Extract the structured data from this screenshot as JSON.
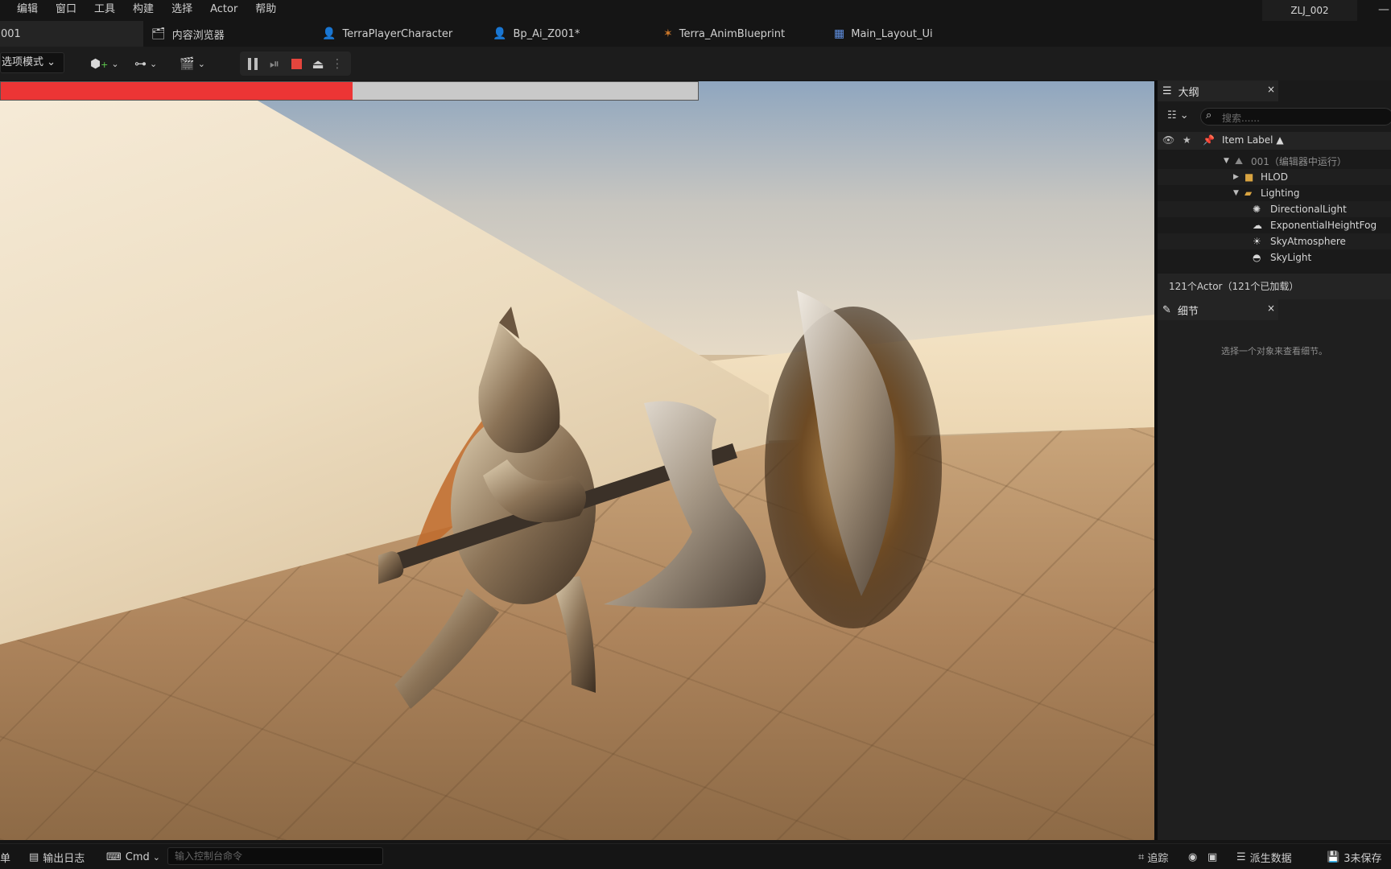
{
  "menubar": {
    "items": [
      "编辑",
      "窗口",
      "工具",
      "构建",
      "选择",
      "Actor",
      "帮助"
    ],
    "project_name": "ZLJ_002",
    "minimize": "—"
  },
  "tabs": [
    {
      "label": "001",
      "icon": "level-icon"
    },
    {
      "label": "内容浏览器",
      "icon": "content-browser-icon"
    },
    {
      "label": "TerraPlayerCharacter",
      "icon": "blueprint-character-icon"
    },
    {
      "label": "Bp_Ai_Z001*",
      "icon": "blueprint-character-icon"
    },
    {
      "label": "Terra_AnimBlueprint",
      "icon": "anim-blueprint-icon"
    },
    {
      "label": "Main_Layout_Ui",
      "icon": "widget-blueprint-icon"
    }
  ],
  "toolbar": {
    "mode_label": "选项模式",
    "icons": [
      "add-actor-icon",
      "blueprint-icon",
      "cinematics-icon"
    ],
    "play_controls": [
      "pause-icon",
      "step-icon",
      "stop-icon",
      "eject-icon",
      "more-icon"
    ]
  },
  "viewport": {
    "health_fraction": 0.505
  },
  "outliner": {
    "tab_label": "大纲",
    "close": "×",
    "search_placeholder": "搜索......",
    "header_label": "Item Label ▲",
    "rows": [
      {
        "label": "001（编辑器中运行）",
        "icon": "world-icon",
        "arrow": "▼",
        "muted": true
      },
      {
        "label": "HLOD",
        "icon": "folder-icon",
        "arrow": "▶"
      },
      {
        "label": "Lighting",
        "icon": "folder-open-icon",
        "arrow": "▼"
      },
      {
        "label": "DirectionalLight",
        "icon": "directional-light-icon",
        "arrow": ""
      },
      {
        "label": "ExponentialHeightFog",
        "icon": "fog-icon",
        "arrow": ""
      },
      {
        "label": "SkyAtmosphere",
        "icon": "sky-atmosphere-icon",
        "arrow": ""
      },
      {
        "label": "SkyLight",
        "icon": "sky-light-icon",
        "arrow": ""
      }
    ],
    "footer": "121个Actor（121个已加载）"
  },
  "details": {
    "tab_label": "细节",
    "close": "×",
    "empty_message": "选择一个对象来查看细节。"
  },
  "statusbar": {
    "left_label": "单",
    "output_log": "输出日志",
    "cmd_label": "Cmd",
    "console_placeholder": "输入控制台命令",
    "trace_label": "追踪",
    "derived_data": "派生数据",
    "unsaved": "3未保存"
  },
  "colors": {
    "health_red": "#ec3535",
    "stop_red": "#e4453d",
    "panel_bg": "#1a1a1a"
  }
}
